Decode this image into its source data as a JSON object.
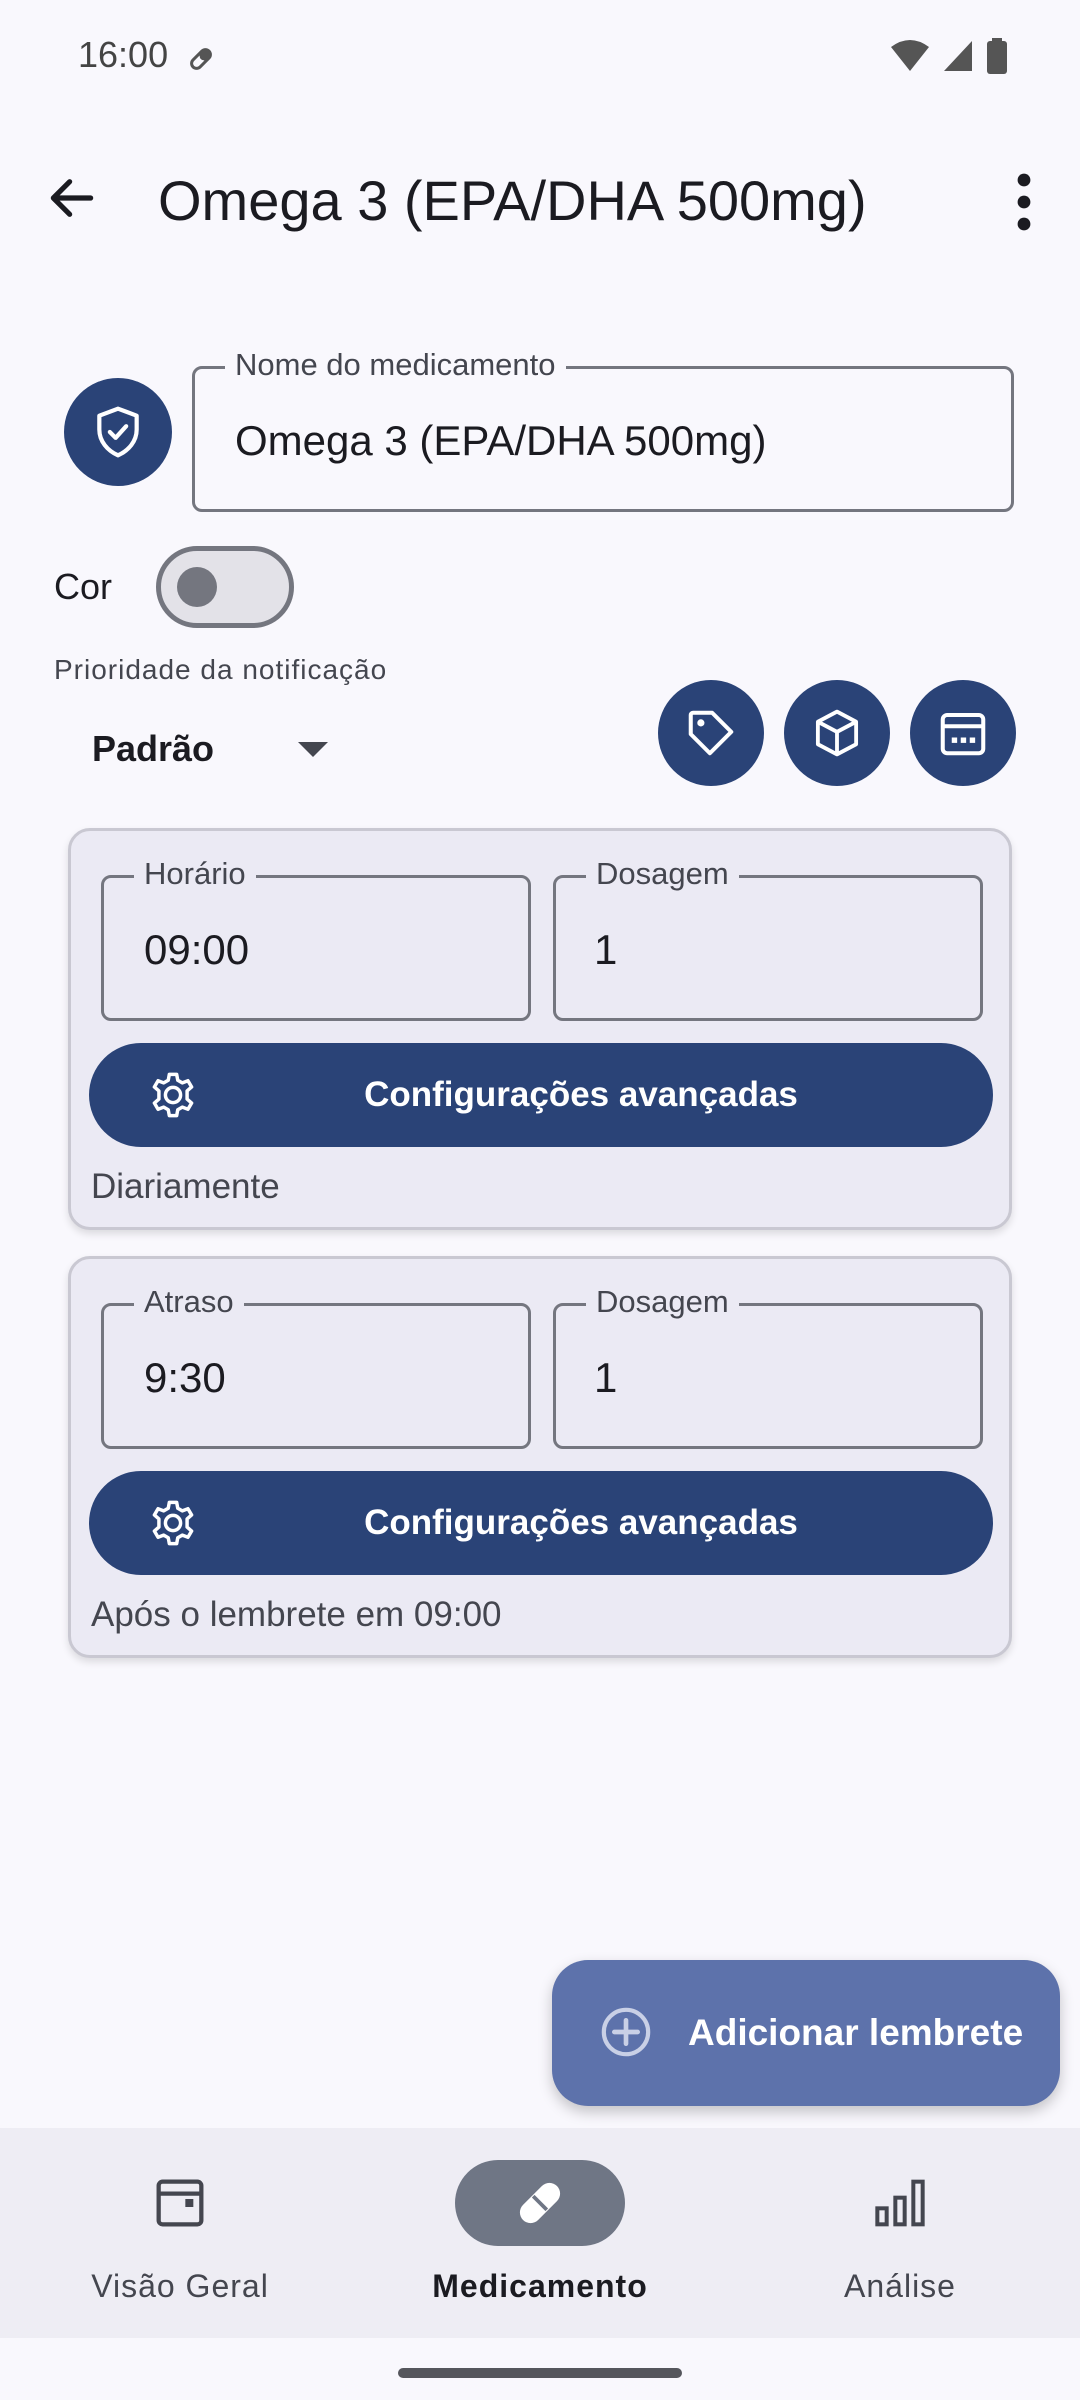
{
  "status_bar": {
    "time": "16:00"
  },
  "app_bar": {
    "title": "Omega 3 (EPA/DHA 500mg)"
  },
  "name_field": {
    "label": "Nome do medicamento",
    "value": "Omega 3 (EPA/DHA 500mg)"
  },
  "color": {
    "label": "Cor",
    "enabled": false
  },
  "priority": {
    "label": "Prioridade da notificação",
    "selected": "Padrão"
  },
  "reminders": [
    {
      "time_label": "Horário",
      "time_value": "09:00",
      "dose_label": "Dosagem",
      "dose_value": "1",
      "advanced_label": "Configurações avançadas",
      "note": "Diariamente"
    },
    {
      "time_label": "Atraso",
      "time_value": "9:30",
      "dose_label": "Dosagem",
      "dose_value": "1",
      "advanced_label": "Configurações avançadas",
      "note": "Após o lembrete em 09:00"
    }
  ],
  "fab": {
    "label": "Adicionar lembrete",
    "icon": "add-circle-icon"
  },
  "bottom_nav": {
    "items": [
      {
        "label": "Visão Geral",
        "icon": "calendar-icon",
        "active": false
      },
      {
        "label": "Medicamento",
        "icon": "pill-icon",
        "active": true
      },
      {
        "label": "Análise",
        "icon": "bar-chart-icon",
        "active": false
      }
    ]
  },
  "colors": {
    "primary": "#2a4377",
    "fab": "#5d72ab",
    "card_bg": "#ebeaf4",
    "background": "#f9f8fd",
    "nav_active_pill": "#6f7685"
  }
}
